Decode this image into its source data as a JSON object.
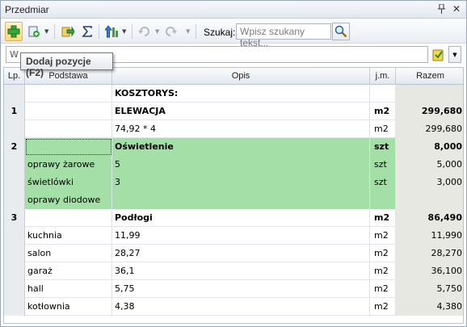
{
  "panel": {
    "title": "Przedmiar"
  },
  "toolbar": {
    "search_label": "Szukaj:",
    "search_placeholder": "Wpisz szukany tekst...",
    "tooltip": "Dodaj pozycje (F2)"
  },
  "filter": {
    "value": "W"
  },
  "grid": {
    "headers": {
      "lp": "Lp.",
      "podstawa": "Podstawa",
      "opis": "Opis",
      "jm": "j.m.",
      "razem": "Razem"
    },
    "rows": [
      {
        "lp": "",
        "podstawa": "",
        "opis": "KOSZTORYS:",
        "jm": "",
        "razem": ""
      },
      {
        "lp": "1",
        "podstawa": "",
        "opis": "ELEWACJA",
        "jm": "m2",
        "razem": "299,680"
      },
      {
        "lp": "",
        "podstawa": "",
        "opis": "74,92 * 4",
        "jm": "m2",
        "razem": "299,680"
      },
      {
        "lp": "2",
        "podstawa": "",
        "opis": "Oświetlenie",
        "jm": "szt",
        "razem": "8,000"
      },
      {
        "lp": "",
        "podstawa": "oprawy żarowe",
        "opis": "5",
        "jm": "szt",
        "razem": "5,000"
      },
      {
        "lp": "",
        "podstawa": "świetlówki",
        "opis": "3",
        "jm": "szt",
        "razem": "3,000"
      },
      {
        "lp": "",
        "podstawa": "oprawy diodowe",
        "opis": "",
        "jm": "",
        "razem": ""
      },
      {
        "lp": "3",
        "podstawa": "",
        "opis": "Podłogi",
        "jm": "m2",
        "razem": "86,490"
      },
      {
        "lp": "",
        "podstawa": "kuchnia",
        "opis": "11,99",
        "jm": "m2",
        "razem": "11,990"
      },
      {
        "lp": "",
        "podstawa": "salon",
        "opis": "28,27",
        "jm": "m2",
        "razem": "28,270"
      },
      {
        "lp": "",
        "podstawa": "garaż",
        "opis": "36,1",
        "jm": "m2",
        "razem": "36,100"
      },
      {
        "lp": "",
        "podstawa": "hall",
        "opis": "5,75",
        "jm": "m2",
        "razem": "5,750"
      },
      {
        "lp": "",
        "podstawa": "kotłownia",
        "opis": "4,38",
        "jm": "m2",
        "razem": "4,380"
      }
    ]
  },
  "colors": {
    "highlight_green": "#a4dfa8",
    "razem_bg": "#e8e8e3"
  },
  "icons": [
    "add-position-icon",
    "add-item-icon",
    "move-icon",
    "sum-icon",
    "sort-icon",
    "undo-icon",
    "redo-icon",
    "search-icon",
    "filter-icon"
  ]
}
